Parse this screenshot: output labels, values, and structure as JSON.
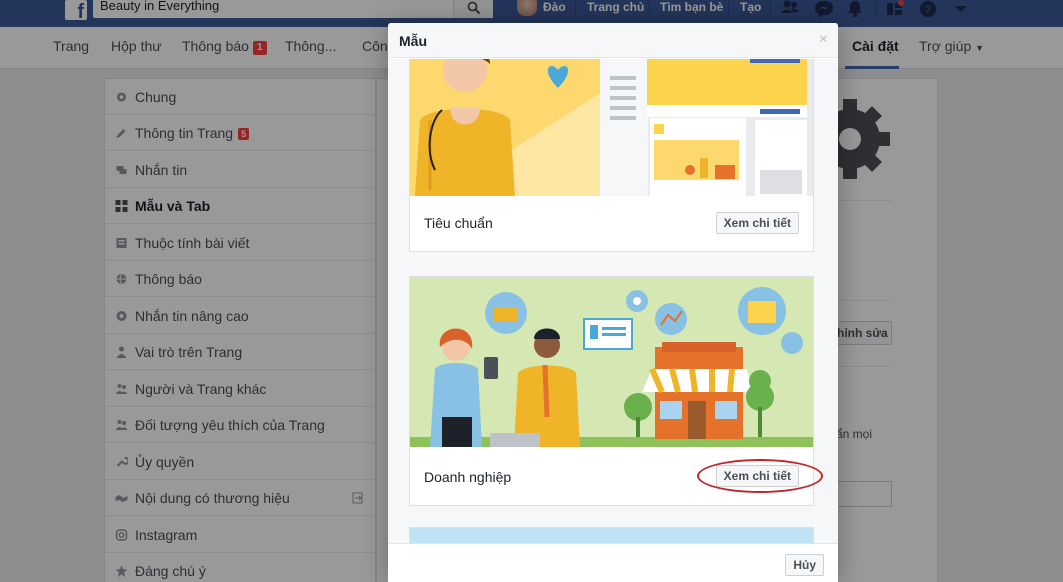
{
  "topbar": {
    "search_value": "Beauty in Everything",
    "user_name": "Đào",
    "links": [
      "Trang chủ",
      "Tìm bạn bè",
      "Tạo"
    ],
    "icons": [
      "friends-icon",
      "messenger-icon",
      "notifications-icon",
      "pages-icon",
      "help-icon",
      "dropdown-icon"
    ]
  },
  "pagenav": {
    "items": [
      {
        "label": "Trang"
      },
      {
        "label": "Hộp thư"
      },
      {
        "label": "Thông báo",
        "badge": "1"
      },
      {
        "label": "Thông..."
      },
      {
        "label": "Công"
      },
      {
        "label": "Cài đặt"
      },
      {
        "label": "Trợ giúp"
      }
    ]
  },
  "sidemenu": {
    "items": [
      {
        "label": "Chung",
        "icon": "gear-icon"
      },
      {
        "label": "Thông tin Trang",
        "icon": "pencil-icon",
        "badge": "5"
      },
      {
        "label": "Nhắn tin",
        "icon": "chat-icon"
      },
      {
        "label": "Mẫu và Tab",
        "icon": "grid-icon",
        "active": true
      },
      {
        "label": "Thuộc tính bài viết",
        "icon": "post-icon"
      },
      {
        "label": "Thông báo",
        "icon": "globe-icon"
      },
      {
        "label": "Nhắn tin nâng cao",
        "icon": "chat-gear-icon"
      },
      {
        "label": "Vai trò trên Trang",
        "icon": "person-icon"
      },
      {
        "label": "Người và Trang khác",
        "icon": "people-icon"
      },
      {
        "label": "Đối tượng yêu thích của Trang",
        "icon": "people-icon"
      },
      {
        "label": "Ủy quyền",
        "icon": "wrench-icon"
      },
      {
        "label": "Nội dung có thương hiệu",
        "icon": "handshake-icon"
      },
      {
        "label": "Instagram",
        "icon": "instagram-icon"
      },
      {
        "label": "Đáng chú ý",
        "icon": "star-icon"
      }
    ]
  },
  "background": {
    "edit_button": "hỉnh sửa",
    "snippet": "ẩn mọi"
  },
  "dialog": {
    "title": "Mẫu",
    "close": "×",
    "cards": [
      {
        "name": "Tiêu chuẩn",
        "button": "Xem chi tiết"
      },
      {
        "name": "Doanh nghiệp",
        "button": "Xem chi tiết"
      }
    ],
    "cancel": "Hủy"
  },
  "colors": {
    "facebook_blue": "#3b5998",
    "badge_red": "#fa3e3e",
    "annotation_red": "#c1272d"
  }
}
